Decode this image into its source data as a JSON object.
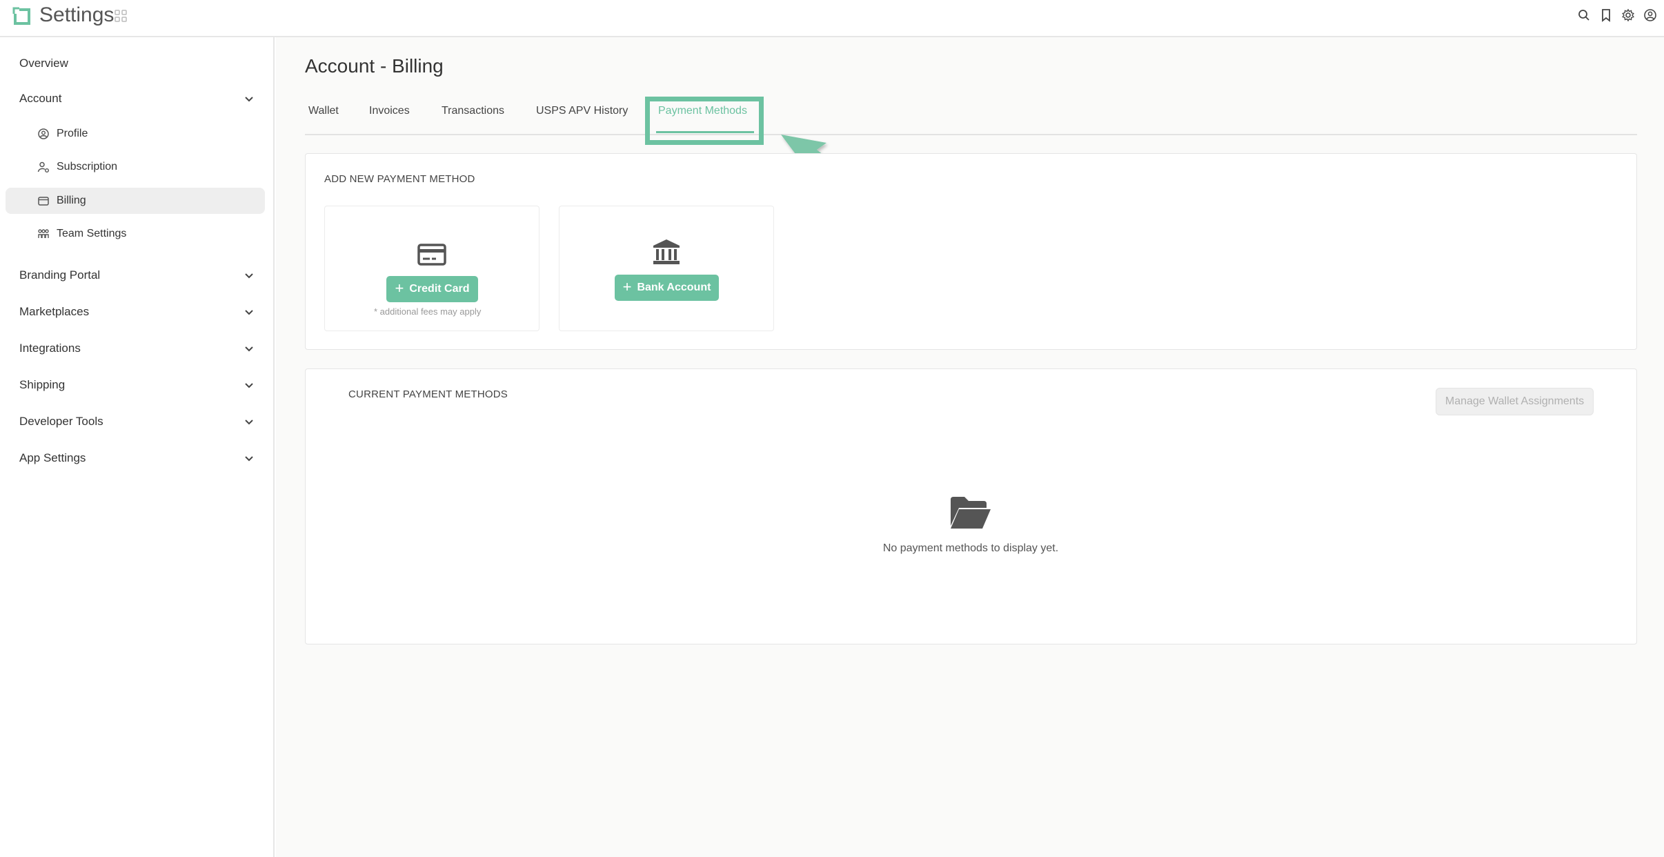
{
  "header": {
    "app_title": "Settings",
    "icons": [
      "search-icon",
      "bookmark-icon",
      "gear-icon",
      "user-circle-icon"
    ],
    "accent_color": "#6cc2a1"
  },
  "sidebar": {
    "top_item": "Overview",
    "account": {
      "label": "Account",
      "children": [
        {
          "label": "Profile",
          "icon": "user-circle-icon"
        },
        {
          "label": "Subscription",
          "icon": "user-gear-icon"
        },
        {
          "label": "Billing",
          "icon": "wallet-icon",
          "active": true
        },
        {
          "label": "Team Settings",
          "icon": "team-icon"
        }
      ]
    },
    "sections": [
      "Branding Portal",
      "Marketplaces",
      "Integrations",
      "Shipping",
      "Developer Tools",
      "App Settings"
    ]
  },
  "main": {
    "page_title": "Account - Billing",
    "tabs": [
      {
        "label": "Wallet"
      },
      {
        "label": "Invoices"
      },
      {
        "label": "Transactions"
      },
      {
        "label": "USPS APV History"
      },
      {
        "label": "Payment Methods",
        "active": true
      }
    ],
    "add_section": {
      "title": "ADD NEW PAYMENT METHOD",
      "credit_card_label": "Credit Card",
      "credit_card_note": "* additional fees may apply",
      "bank_account_label": "Bank Account"
    },
    "current_section": {
      "title": "CURRENT PAYMENT METHODS",
      "manage_button": "Manage Wallet Assignments",
      "empty_message": "No payment methods to display yet."
    }
  }
}
